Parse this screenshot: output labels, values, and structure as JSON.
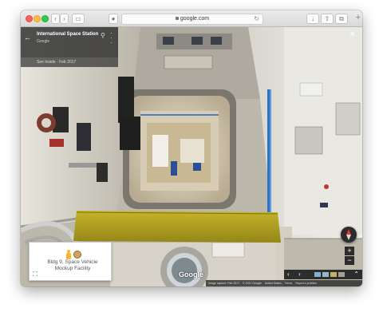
{
  "browser": {
    "url": "google.com"
  },
  "panel": {
    "title": "International Space Station",
    "subtitle": "Google",
    "see_inside": "See Inside · Feb 2017"
  },
  "placecard": {
    "line1": "Bldg 9, Space Vehicle",
    "line2": "Mockup Facility"
  },
  "controls": {
    "zoom_in": "+",
    "zoom_out": "−"
  },
  "logo": "Google",
  "footer": {
    "capture": "Image capture: Feb 2017",
    "copyright": "© 2017 Google",
    "country": "United States",
    "terms": "Terms",
    "report": "Report a problem"
  },
  "colors": {
    "handrail_blue": "#2c73c2",
    "mat_yellow": "#b6a51f",
    "panel_dark": "#2d2d2d"
  }
}
